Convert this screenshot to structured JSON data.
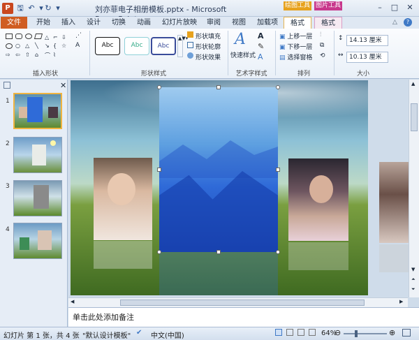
{
  "window": {
    "title": "刘亦菲电子相册模板.pptx - Microsoft PowerPoint",
    "app_logo": "P",
    "context_tabs": [
      "绘图工具",
      "图片工具"
    ],
    "controls": [
      "–",
      "□",
      "✕"
    ]
  },
  "quick_access": [
    "save-icon",
    "undo-icon",
    "redo-icon",
    "customize-icon"
  ],
  "tabs": [
    "文件",
    "开始",
    "插入",
    "设计",
    "切换",
    "动画",
    "幻灯片放映",
    "审阅",
    "视图",
    "加载项",
    "格式",
    "格式"
  ],
  "ribbon": {
    "groups": [
      "插入形状",
      "形状样式",
      "艺术字样式",
      "排列",
      "大小"
    ],
    "style_samples": [
      "Abc",
      "Abc",
      "Abc"
    ],
    "shape_fill": "形状填充",
    "shape_outline": "形状轮廓",
    "shape_effect": "形状效果",
    "quick_style": "快速样式",
    "bring_forward": "上移一层",
    "send_backward": "下移一层",
    "selection_pane": "选择窗格",
    "height": "14.13 厘米",
    "width": "10.13 厘米"
  },
  "slides": [
    {
      "num": "1"
    },
    {
      "num": "2"
    },
    {
      "num": "3"
    },
    {
      "num": "4"
    }
  ],
  "notes_placeholder": "单击此处添加备注",
  "status": {
    "slide_info": "幻灯片 第 1 张，共 4 张",
    "theme": "\"默认设计模板\"",
    "language": "中文(中国)",
    "zoom": "64%"
  },
  "colors": {
    "file_tab": "#d05d22",
    "drawing_tools": "#e7a21d",
    "picture_tools": "#c8388c",
    "accent": "#3f79c6"
  }
}
